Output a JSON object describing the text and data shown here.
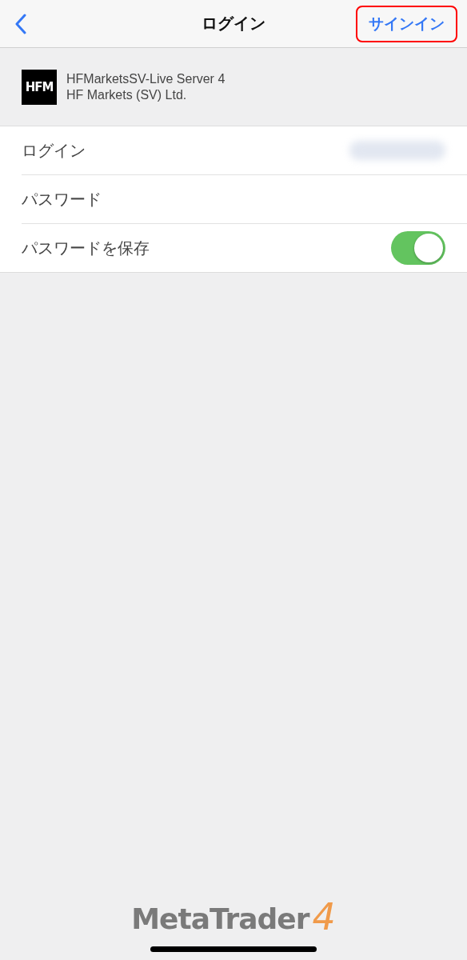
{
  "nav": {
    "title": "ログイン",
    "action": {
      "label": "サインイン",
      "highlighted": true
    }
  },
  "server": {
    "logo_text": "HFM",
    "name": "HFMarketsSV-Live Server 4",
    "company": "HF Markets (SV) Ltd."
  },
  "rows": [
    {
      "kind": "field",
      "label": "ログイン",
      "value_hidden": true
    },
    {
      "kind": "field",
      "label": "パスワード",
      "value_hidden": false
    },
    {
      "kind": "toggle",
      "label": "パスワードを保存",
      "on": true
    }
  ],
  "footer_logo": {
    "name": "MetaTrader",
    "version": "4"
  }
}
